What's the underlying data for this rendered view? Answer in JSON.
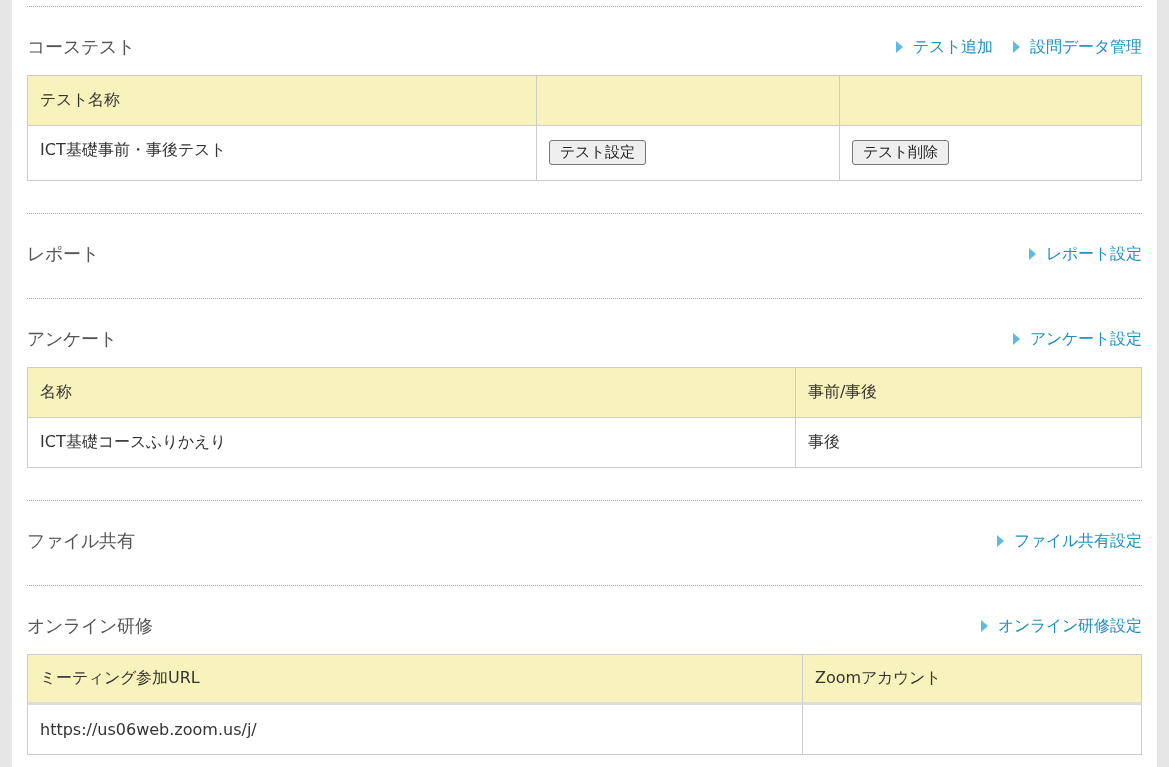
{
  "sections": [
    {
      "title": "コーステスト",
      "links": [
        "テスト追加",
        "設問データ管理"
      ],
      "table": {
        "columns": [
          {
            "label": "テスト名称"
          },
          {},
          {}
        ],
        "rows": [
          {
            "cells": [
              {
                "kind": "text",
                "text": "ICT基礎事前・事後テスト"
              },
              {
                "kind": "button",
                "label": "テスト設定"
              },
              {
                "kind": "button",
                "label": "テスト削除"
              }
            ]
          }
        ]
      }
    },
    {
      "title": "レポート",
      "links": [
        "レポート設定"
      ]
    },
    {
      "title": "アンケート",
      "links": [
        "アンケート設定"
      ],
      "table": {
        "columns": [
          {
            "label": "名称"
          },
          {
            "label": "事前/事後"
          }
        ],
        "rows": [
          {
            "cells": [
              {
                "kind": "text",
                "text": "ICT基礎コースふりかえり"
              },
              {
                "kind": "text",
                "text": "事後"
              }
            ]
          }
        ]
      }
    },
    {
      "title": "ファイル共有",
      "links": [
        "ファイル共有設定"
      ]
    },
    {
      "title": "オンライン研修",
      "links": [
        "オンライン研修設定"
      ],
      "table": {
        "columns": [
          {
            "label": "ミーティング参加URL"
          },
          {
            "label": "Zoomアカウント"
          }
        ],
        "rows": [
          {
            "cells": [
              {
                "kind": "text",
                "text": "https://us06web.zoom.us/j/"
              },
              {
                "kind": "empty"
              }
            ]
          }
        ]
      }
    }
  ]
}
